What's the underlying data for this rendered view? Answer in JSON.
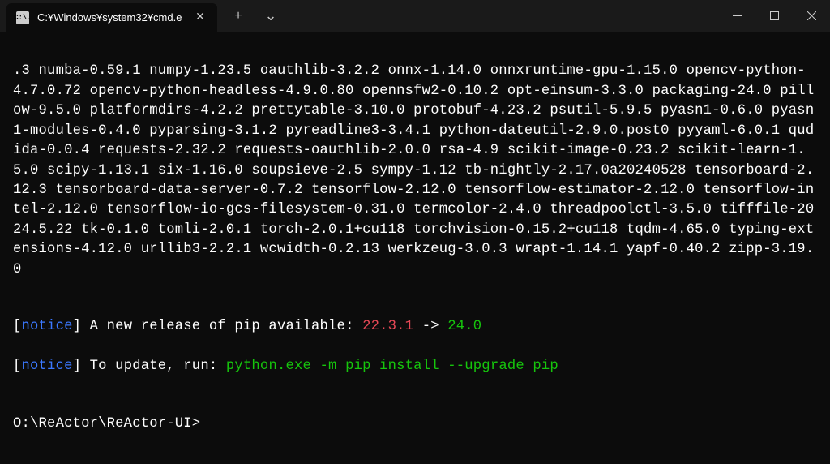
{
  "titlebar": {
    "tab_icon_text": "C:\\.",
    "tab_title": "C:¥Windows¥system32¥cmd.e",
    "close_glyph": "✕",
    "add_glyph": "+",
    "dropdown_glyph": "⌄"
  },
  "terminal": {
    "packages_text": ".3 numba-0.59.1 numpy-1.23.5 oauthlib-3.2.2 onnx-1.14.0 onnxruntime-gpu-1.15.0 opencv-python-4.7.0.72 opencv-python-headless-4.9.0.80 opennsfw2-0.10.2 opt-einsum-3.3.0 packaging-24.0 pillow-9.5.0 platformdirs-4.2.2 prettytable-3.10.0 protobuf-4.23.2 psutil-5.9.5 pyasn1-0.6.0 pyasn1-modules-0.4.0 pyparsing-3.1.2 pyreadline3-3.4.1 python-dateutil-2.9.0.post0 pyyaml-6.0.1 qudida-0.0.4 requests-2.32.2 requests-oauthlib-2.0.0 rsa-4.9 scikit-image-0.23.2 scikit-learn-1.5.0 scipy-1.13.1 six-1.16.0 soupsieve-2.5 sympy-1.12 tb-nightly-2.17.0a20240528 tensorboard-2.12.3 tensorboard-data-server-0.7.2 tensorflow-2.12.0 tensorflow-estimator-2.12.0 tensorflow-intel-2.12.0 tensorflow-io-gcs-filesystem-0.31.0 termcolor-2.4.0 threadpoolctl-3.5.0 tifffile-2024.5.22 tk-0.1.0 tomli-2.0.1 torch-2.0.1+cu118 torchvision-0.15.2+cu118 tqdm-4.65.0 typing-extensions-4.12.0 urllib3-2.2.1 wcwidth-0.2.13 werkzeug-3.0.3 wrapt-1.14.1 yapf-0.40.2 zipp-3.19.0",
    "notice1": {
      "bracket_open": "[",
      "tag": "notice",
      "bracket_close": "]",
      "msg_a": " A new release of pip available: ",
      "old_ver": "22.3.1",
      "arrow": " -> ",
      "new_ver": "24.0"
    },
    "notice2": {
      "bracket_open": "[",
      "tag": "notice",
      "bracket_close": "]",
      "msg_a": " To update, run: ",
      "cmd": "python.exe -m pip install --upgrade pip"
    },
    "prompt": "O:\\ReActor\\ReActor-UI>"
  }
}
